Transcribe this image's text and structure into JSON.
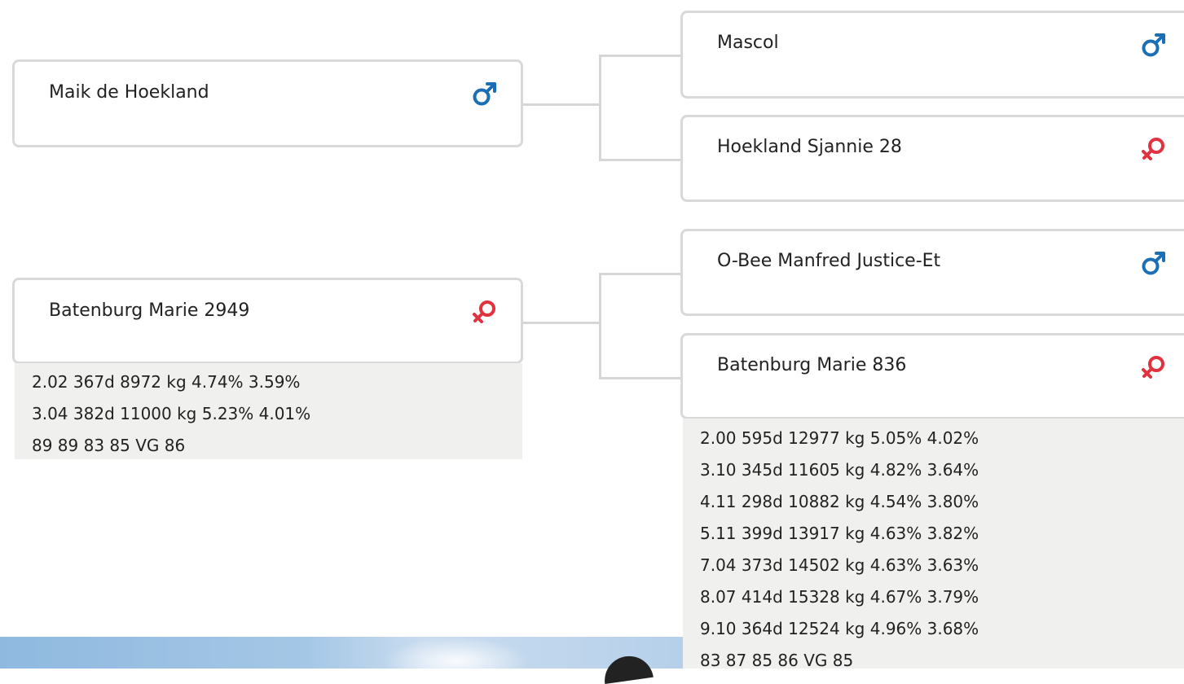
{
  "pedigree": {
    "sire": {
      "name": "Maik de Hoekland",
      "sex": "male"
    },
    "dam": {
      "name": "Batenburg Marie 2949",
      "sex": "female",
      "stats": [
        "2.02 367d 8972 kg 4.74% 3.59%",
        "3.04 382d 11000 kg 5.23% 4.01%",
        "89 89 83 85 VG 86"
      ]
    },
    "sire_sire": {
      "name": "Mascol",
      "sex": "male"
    },
    "sire_dam": {
      "name": "Hoekland Sjannie 28",
      "sex": "female"
    },
    "dam_sire": {
      "name": "O-Bee Manfred Justice-Et",
      "sex": "male"
    },
    "dam_dam": {
      "name": "Batenburg Marie 836",
      "sex": "female",
      "stats": [
        "2.00 595d 12977 kg 5.05% 4.02%",
        "3.10 345d 11605 kg 4.82% 3.64%",
        "4.11 298d 10882 kg 4.54% 3.80%",
        "5.11 399d 13917 kg 4.63% 3.82%",
        "7.04 373d 14502 kg 4.63% 3.63%",
        "8.07 414d 15328 kg 4.67% 3.79%",
        "9.10 364d 12524 kg 4.96% 3.68%",
        "83 87 85 86 VG 85"
      ]
    }
  },
  "icons": {
    "male": "male-symbol-icon",
    "female": "female-symbol-icon"
  },
  "colors": {
    "male": "#1a6fb5",
    "female": "#e0323f",
    "border": "#d9d9d9",
    "stats_bg": "#f0f0ee"
  }
}
